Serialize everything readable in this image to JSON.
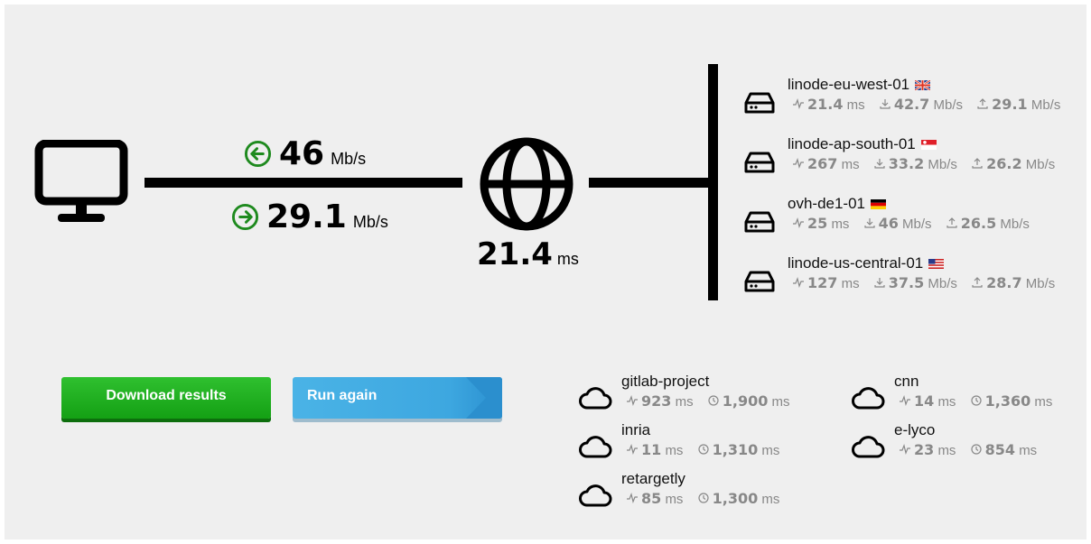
{
  "client": {
    "download": {
      "value": "46",
      "unit": "Mb/s"
    },
    "upload": {
      "value": "29.1",
      "unit": "Mb/s"
    }
  },
  "internet": {
    "latency": {
      "value": "21.4",
      "unit": "ms"
    }
  },
  "servers": [
    {
      "name": "linode-eu-west-01",
      "flag": "gb-flag",
      "ping": "21.4",
      "ping_unit": "ms",
      "down": "42.7",
      "down_unit": "Mb/s",
      "up": "29.1",
      "up_unit": "Mb/s"
    },
    {
      "name": "linode-ap-south-01",
      "flag": "sg-flag",
      "ping": "267",
      "ping_unit": "ms",
      "down": "33.2",
      "down_unit": "Mb/s",
      "up": "26.2",
      "up_unit": "Mb/s"
    },
    {
      "name": "ovh-de1-01",
      "flag": "de-flag",
      "ping": "25",
      "ping_unit": "ms",
      "down": "46",
      "down_unit": "Mb/s",
      "up": "26.5",
      "up_unit": "Mb/s"
    },
    {
      "name": "linode-us-central-01",
      "flag": "us-flag",
      "ping": "127",
      "ping_unit": "ms",
      "down": "37.5",
      "down_unit": "Mb/s",
      "up": "28.7",
      "up_unit": "Mb/s"
    }
  ],
  "buttons": {
    "download": "Download results",
    "run": "Run again"
  },
  "services": [
    {
      "name": "gitlab-project",
      "ping": "923",
      "ping_unit": "ms",
      "load": "1,900",
      "load_unit": "ms"
    },
    {
      "name": "cnn",
      "ping": "14",
      "ping_unit": "ms",
      "load": "1,360",
      "load_unit": "ms"
    },
    {
      "name": "inria",
      "ping": "11",
      "ping_unit": "ms",
      "load": "1,310",
      "load_unit": "ms"
    },
    {
      "name": "e-lyco",
      "ping": "23",
      "ping_unit": "ms",
      "load": "854",
      "load_unit": "ms"
    },
    {
      "name": "retargetly",
      "ping": "85",
      "ping_unit": "ms",
      "load": "1,300",
      "load_unit": "ms"
    }
  ],
  "colors": {
    "arrow": "#1e8a1e",
    "download_button": "#1aa81a",
    "run_button": "#3ea9e2"
  }
}
